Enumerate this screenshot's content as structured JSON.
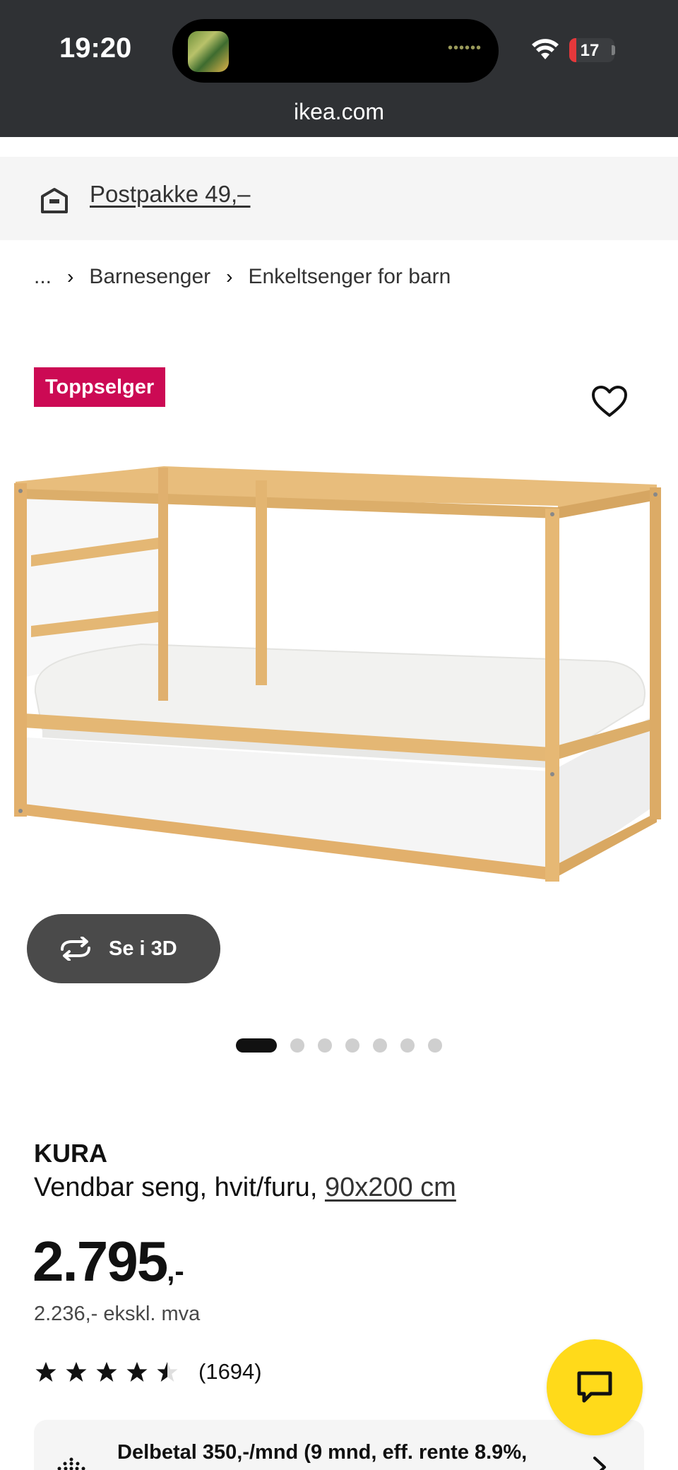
{
  "status_bar": {
    "time": "19:20",
    "battery": "17",
    "battery_level_pct": 17
  },
  "browser": {
    "url": "ikea.com"
  },
  "delivery": {
    "icon": "package-box-icon",
    "text": "Postpakke 49,–"
  },
  "breadcrumb": {
    "ellipsis": "...",
    "items": [
      "Barnesenger",
      "Enkeltsenger for barn"
    ]
  },
  "product": {
    "badge": "Toppselger",
    "view_3d_label": "Se i 3D",
    "carousel_count": 7,
    "carousel_active": 0,
    "name": "KURA",
    "description": "Vendbar seng, hvit/furu, ",
    "size": "90x200 cm",
    "price": "2.795",
    "price_suffix": ",-",
    "price_ex_vat": "2.236,- ekskl. mva",
    "rating_value": 4.5,
    "rating_count": "(1694)"
  },
  "financing": {
    "text": "Delbetal 350,-/mnd (9 mnd, eff. rente 8.9%,"
  },
  "colors": {
    "badge": "#cc0a54",
    "chat_button": "#ffda1a",
    "topbar": "#2f3134"
  }
}
